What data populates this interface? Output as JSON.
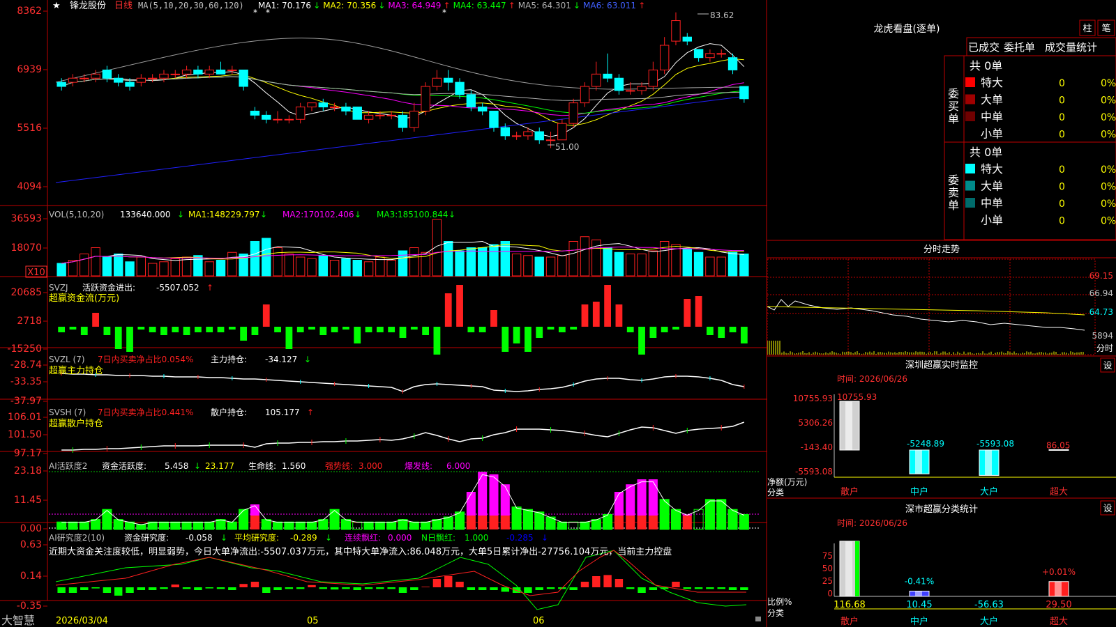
{
  "stock": {
    "name": "锋龙股份",
    "period": "日线",
    "star": "★"
  },
  "colors": {
    "up": "#ff2020",
    "down": "#00ffff",
    "ma1": "#ffffff",
    "ma2": "#ffff00",
    "ma3": "#ff00ff",
    "ma4": "#00ff00",
    "ma5": "#b0b0b0",
    "ma6": "#2020ff",
    "grid": "#c00000",
    "text": "#c0c0c0",
    "bg": "#000000",
    "green": "#00ff00",
    "magenta": "#ff00ff",
    "yellow": "#ffff00"
  },
  "price_panel": {
    "ma_label": "MA(5,10,20,30,60,120)",
    "ma_values": [
      {
        "name": "MA1:",
        "value": "70.176",
        "arrow": "↓"
      },
      {
        "name": "MA2:",
        "value": "70.356",
        "arrow": "↓"
      },
      {
        "name": "MA3:",
        "value": "64.949",
        "arrow": "↑"
      },
      {
        "name": "MA4:",
        "value": "63.447",
        "arrow": "↑"
      },
      {
        "name": "MA5:",
        "value": "64.301",
        "arrow": "↓"
      },
      {
        "name": "MA6:",
        "value": "63.011",
        "arrow": "↑"
      }
    ],
    "axis_ticks": [
      "8362",
      "6939",
      "5516",
      "4094"
    ],
    "high_label": "83.62",
    "low_label": "51.00"
  },
  "vol_panel": {
    "label": "VOL(5,10,20)",
    "value": "133640.000",
    "value_arrow": "↓",
    "mas": [
      {
        "name": "MA1:",
        "value": "148229.797",
        "arrow": "↓"
      },
      {
        "name": "MA2:",
        "value": "170102.406",
        "arrow": "↓"
      },
      {
        "name": "MA3:",
        "value": "185100.844",
        "arrow": "↓"
      }
    ],
    "axis_ticks": [
      "36593",
      "18070"
    ],
    "unit": "X10"
  },
  "svzj_panel": {
    "label": "SVZJ",
    "desc": "活跃资金进出:",
    "value": "-5507.052",
    "arrow": "↑",
    "subtitle": "超赢资金流(万元)",
    "axis_ticks": [
      "20685",
      "2718",
      "-15250"
    ]
  },
  "svzl_panel": {
    "label": "SVZL (7)",
    "desc": "7日内买卖净占比0.054%",
    "desc2": "主力持仓:",
    "value": "-34.127",
    "arrow": "↓",
    "subtitle": "超赢主力持仓",
    "axis_ticks": [
      "-28.74",
      "-33.35",
      "-37.97"
    ]
  },
  "svsh_panel": {
    "label": "SVSH (7)",
    "desc": "7日内买卖净占比0.441%",
    "desc2": "散户持仓:",
    "value": "105.177",
    "arrow": "↑",
    "subtitle": "超赢散户持仓",
    "axis_ticks": [
      "106.01",
      "101.50",
      "97.17"
    ]
  },
  "ai_panel": {
    "label": "AI活跃度2",
    "d1": "资金活跃度:",
    "v1": "5.458",
    "a1": "↓",
    "v2": "23.177",
    "d3": "生命线:",
    "v3": "1.560",
    "d4": "强势线:",
    "v4": "3.000",
    "d5": "爆发线:",
    "v5": "6.000",
    "axis_ticks": [
      "23.18",
      "11.45",
      "0.00"
    ]
  },
  "ai2_panel": {
    "label": "AI研究度2(10)",
    "d1": "资金研究度:",
    "v1": "-0.058",
    "a1": "↓",
    "d2": "平均研究度:",
    "v2": "-0.289",
    "a2": "↓",
    "d3": "连续飘红:",
    "v3": "0.000",
    "d4": "N日飘红:",
    "v4": "1.000",
    "v5": "-0.285",
    "a5": "↓",
    "commentary": "近期大资金关注度较低，明显弱势，今日大单净流出:-5507.037万元，其中特大单净流入:86.048万元，大单5日累计净出-27756.104万元，当前主力控盘",
    "axis_ticks": [
      "0.63",
      "0.14",
      "-0.35"
    ]
  },
  "date_axis": {
    "app": "大智慧",
    "labels": [
      "2026/03/04",
      "05",
      "06"
    ]
  },
  "longhu": {
    "title": "龙虎看盘(逐单)",
    "btn1": "柱",
    "btn2": "笔",
    "tabs": [
      "已成交",
      "委托单",
      "成交量统计"
    ],
    "buy": {
      "side": "委\n买\n单",
      "total": "共 0单",
      "rows": [
        {
          "label": "特大",
          "val": "0",
          "pct": "0%",
          "color": "#ff0000"
        },
        {
          "label": "大单",
          "val": "0",
          "pct": "0%",
          "color": "#a00000"
        },
        {
          "label": "中单",
          "val": "0",
          "pct": "0%",
          "color": "#700000"
        },
        {
          "label": "小单",
          "val": "0",
          "pct": "0%",
          "color": ""
        }
      ]
    },
    "sell": {
      "side": "委\n卖\n单",
      "total": "共 0单",
      "rows": [
        {
          "label": "特大",
          "val": "0",
          "pct": "0%",
          "color": "#00ffff"
        },
        {
          "label": "大单",
          "val": "0",
          "pct": "0%",
          "color": "#008b8b"
        },
        {
          "label": "中单",
          "val": "0",
          "pct": "0%",
          "color": "#006b6b"
        },
        {
          "label": "小单",
          "val": "0",
          "pct": "0%",
          "color": ""
        }
      ]
    }
  },
  "fenshi": {
    "title": "分时走势",
    "ticks": [
      "69.15",
      "66.94",
      "64.73",
      "5894"
    ],
    "unit": "分时"
  },
  "sz_monitor": {
    "title": "深圳超赢实时监控",
    "btn": "设",
    "time_label": "时间: 2026/06/26",
    "axis_ticks": [
      "10755.93",
      "5306.26",
      "-143.40",
      "-5593.08"
    ],
    "ylabel": "净额(万元)",
    "xlabel": "分类",
    "bars": [
      {
        "name": "散户",
        "value": 10755.93,
        "label": "10755.93"
      },
      {
        "name": "中户",
        "value": -5248.89,
        "label": "-5248.89"
      },
      {
        "name": "大户",
        "value": -5593.08,
        "label": "-5593.08"
      },
      {
        "name": "超大",
        "value": 86.05,
        "label": "86.05"
      }
    ]
  },
  "sz_class": {
    "title": "深市超赢分类统计",
    "btn": "设",
    "time_label": "时间: 2026/06/26",
    "axis_ticks": [
      "75",
      "50",
      "25",
      "0"
    ],
    "ylabel": "比例%",
    "xlabel": "分类",
    "bars": [
      {
        "name": "散户",
        "value": 116.68,
        "label": "116.68",
        "top": ""
      },
      {
        "name": "中户",
        "value": 10.45,
        "label": "10.45",
        "top": "-0.41%"
      },
      {
        "name": "大户",
        "value": -56.63,
        "label": "-56.63",
        "top": ""
      },
      {
        "name": "超大",
        "value": 29.5,
        "label": "29.50",
        "top": "+0.01%"
      }
    ]
  },
  "chart_data": [
    {
      "type": "candlestick",
      "title": "锋龙股份 日线",
      "ylim": [
        40.94,
        83.62
      ],
      "candles": [
        [
          67,
          66,
          68,
          65
        ],
        [
          67,
          68,
          69,
          66
        ],
        [
          68,
          68,
          69,
          67
        ],
        [
          68,
          69,
          70,
          67
        ],
        [
          70,
          68,
          71,
          67
        ],
        [
          68,
          67,
          69,
          66
        ],
        [
          67,
          66,
          68,
          65
        ],
        [
          67,
          68,
          69,
          66
        ],
        [
          68,
          68,
          69,
          67
        ],
        [
          68,
          69,
          70,
          67
        ],
        [
          69,
          69,
          70,
          68
        ],
        [
          69,
          70,
          71,
          68
        ],
        [
          70,
          69,
          71,
          68
        ],
        [
          69,
          70,
          71,
          68
        ],
        [
          70,
          69,
          72,
          69
        ],
        [
          70,
          70,
          71,
          69
        ],
        [
          70,
          66,
          70,
          65
        ],
        [
          60,
          59,
          61,
          58
        ],
        [
          59,
          58,
          60,
          57
        ],
        [
          58,
          58,
          60,
          57
        ],
        [
          58,
          58,
          59,
          57
        ],
        [
          58,
          61,
          62,
          57
        ],
        [
          61,
          62,
          62,
          60
        ],
        [
          62,
          61,
          63,
          60
        ],
        [
          61,
          61,
          62,
          60
        ],
        [
          61,
          60,
          62,
          59
        ],
        [
          61,
          58,
          61,
          58
        ],
        [
          58,
          59,
          60,
          57
        ],
        [
          59,
          59,
          60,
          58
        ],
        [
          59,
          59,
          60,
          58
        ],
        [
          59,
          56,
          60,
          55
        ],
        [
          56,
          60,
          62,
          55
        ],
        [
          60,
          66,
          67,
          59
        ],
        [
          66,
          68,
          70,
          65
        ],
        [
          68,
          67,
          70,
          65
        ],
        [
          67,
          64,
          68,
          63
        ],
        [
          64,
          61,
          65,
          60
        ],
        [
          61,
          60,
          62,
          59
        ],
        [
          60,
          56,
          60,
          55
        ],
        [
          56,
          54,
          57,
          53
        ],
        [
          54,
          54,
          55,
          53
        ],
        [
          54,
          55,
          56,
          53
        ],
        [
          55,
          53,
          56,
          52
        ],
        [
          53,
          53,
          55,
          51
        ],
        [
          53,
          57,
          58,
          53
        ],
        [
          57,
          62,
          63,
          56
        ],
        [
          62,
          66,
          67,
          61
        ],
        [
          66,
          69,
          72,
          65
        ],
        [
          69,
          68,
          74,
          67
        ],
        [
          68,
          65,
          69,
          64
        ],
        [
          65,
          65,
          67,
          64
        ],
        [
          65,
          66,
          67,
          64
        ],
        [
          66,
          70,
          72,
          65
        ],
        [
          70,
          76,
          78,
          69
        ],
        [
          77,
          82,
          84,
          76
        ],
        [
          78,
          77,
          79,
          76
        ],
        [
          75,
          73,
          74,
          72
        ],
        [
          73,
          74,
          75,
          72
        ],
        [
          74,
          74,
          75,
          73
        ],
        [
          73,
          70,
          74,
          69
        ],
        [
          66,
          63,
          66,
          62
        ]
      ],
      "series": [
        {
          "name": "MA1"
        },
        {
          "name": "MA2"
        },
        {
          "name": "MA3"
        },
        {
          "name": "MA4"
        },
        {
          "name": "MA5"
        },
        {
          "name": "MA6"
        }
      ]
    },
    {
      "type": "bar",
      "title": "VOL",
      "values": [
        8,
        10,
        14,
        18,
        12,
        14,
        9,
        12,
        8,
        9,
        11,
        12,
        13,
        9,
        10,
        15,
        14,
        22,
        24,
        18,
        14,
        12,
        11,
        13,
        10,
        11,
        10,
        9,
        12,
        10,
        16,
        18,
        15,
        36,
        22,
        16,
        18,
        18,
        20,
        22,
        14,
        13,
        12,
        12,
        13,
        22,
        25,
        23,
        18,
        15,
        14,
        14,
        16,
        22,
        20,
        17,
        15,
        12,
        12,
        15,
        14
      ],
      "ylim": [
        0,
        36593
      ]
    },
    {
      "type": "bar",
      "title": "SVZJ",
      "values": [
        -2,
        -1,
        -3,
        5,
        -3,
        -8,
        -9,
        -1,
        -2,
        -3,
        -2,
        -3,
        -2,
        -2,
        -2,
        -1,
        -5,
        -3,
        8,
        -2,
        -8,
        -2,
        -1,
        -3,
        -2,
        -1,
        -6,
        -2,
        -2,
        -2,
        -4,
        -1,
        -3,
        -10,
        12,
        15,
        -2,
        -2,
        6,
        -9,
        -6,
        -9,
        -4,
        -1,
        -2,
        -1,
        8,
        9,
        15,
        8,
        -2,
        -10,
        -4,
        -2,
        -1,
        10,
        11,
        -3,
        -4,
        -2,
        -6
      ],
      "ylim": [
        -15250,
        20685
      ]
    }
  ]
}
